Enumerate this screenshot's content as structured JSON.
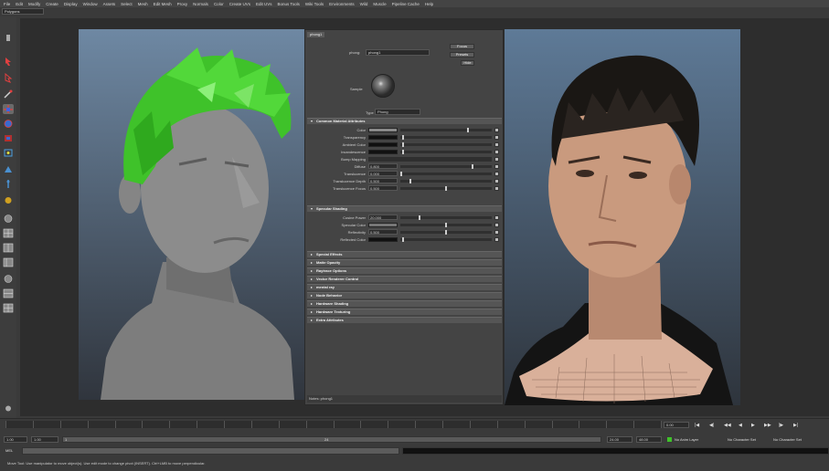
{
  "menubar": {
    "items": [
      "File",
      "Edit",
      "Modify",
      "Create",
      "Display",
      "Window",
      "Assets",
      "Select",
      "Mesh",
      "Edit Mesh",
      "Proxy",
      "Normals",
      "Color",
      "Create UVs",
      "Edit UVs",
      "Bonus Tools",
      "Wiki Tools",
      "Environments",
      "Wild",
      "Muscle",
      "Pipeline Cache",
      "Help"
    ]
  },
  "mode_selector": {
    "value": "Polygons"
  },
  "attribute_editor": {
    "tab": "phong1",
    "node_label": "phong:",
    "node_name": "phong1",
    "focus_button": "Focus",
    "presets_button": "Presets",
    "hide_button": "Hide",
    "sample_label": "Sample",
    "type_label": "Type",
    "type_value": "Phong",
    "notes_label": "Notes: phong1",
    "sections": {
      "common": "Common Material Attributes",
      "specular": "Specular Shading",
      "special_effects": "Special Effects",
      "matte_opacity": "Matte Opacity",
      "raytrace": "Raytrace Options",
      "vector_renderer": "Vector Renderer Control",
      "mental_ray": "mental ray",
      "node_behavior": "Node Behavior",
      "hardware_shading": "Hardware Shading",
      "hardware_texturing": "Hardware Texturing",
      "extra": "Extra Attributes"
    },
    "common_rows": {
      "color": {
        "label": "Color",
        "swatch": "#8a8a8a",
        "level": 0.74
      },
      "transparency": {
        "label": "Transparency",
        "swatch": "#111111",
        "level": 0.02
      },
      "ambient": {
        "label": "Ambient Color",
        "swatch": "#111111",
        "level": 0.02
      },
      "incandescence": {
        "label": "Incandescence",
        "swatch": "#111111",
        "level": 0.02
      },
      "bump": {
        "label": "Bump Mapping"
      },
      "diffuse": {
        "label": "Diffuse",
        "value": "0.800",
        "level": 0.8
      },
      "translucence": {
        "label": "Translucence",
        "value": "0.000",
        "level": 0.0
      },
      "translucence_depth": {
        "label": "Translucence Depth",
        "value": "0.500",
        "level": 0.1
      },
      "translucence_focus": {
        "label": "Translucence Focus",
        "value": "0.500",
        "level": 0.5
      }
    },
    "specular_rows": {
      "cosine_power": {
        "label": "Cosine Power",
        "value": "20.000",
        "level": 0.2
      },
      "specular_color": {
        "label": "Specular Color",
        "swatch": "#777777",
        "level": 0.5
      },
      "reflectivity": {
        "label": "Reflectivity",
        "value": "0.500",
        "level": 0.5
      },
      "reflected_color": {
        "label": "Reflected Color",
        "swatch": "#111111",
        "level": 0.02
      }
    }
  },
  "timeline": {
    "current_frame": "0.00",
    "playback_buttons": [
      "|◀",
      "◀|",
      "◀◀",
      "◀",
      "▶",
      "▶▶",
      "|▶",
      "▶|"
    ]
  },
  "range_bar": {
    "start_time": "1.00",
    "start_range": "1.00",
    "slider_start": "1",
    "slider_end": "24",
    "end_range": "24.00",
    "end_time": "48.00",
    "anim_layer": "No Anim Layer",
    "char_set": "No Character Set"
  },
  "command_line": {
    "label": "MEL"
  },
  "help_line": {
    "text": "Move Tool: Use manipulator to move object(s). Use edit mode to change pivot (INSERT). Ctrl+LMB to move perpendicular."
  },
  "colors": {
    "hair_green": "#3fc22a",
    "skin_tone": "#c99a7e",
    "hair_dark": "#1a1714",
    "clay_grey": "#8c8c8c"
  }
}
